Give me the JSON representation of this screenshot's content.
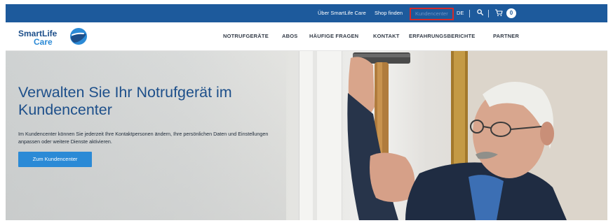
{
  "topbar": {
    "about_label": "Über SmartLife Care",
    "shop_label": "Shop finden",
    "kundencenter_label": "Kundencenter",
    "language_label": "DE",
    "search_icon": "search-icon",
    "cart_icon": "cart-icon",
    "cart_count": "0",
    "colors": {
      "bar": "#1d5a9c",
      "highlight_border": "#d42a2a"
    }
  },
  "header": {
    "logo": {
      "line1": "SmartLife",
      "line2": "Care"
    },
    "nav": [
      {
        "label": "NOTRUFGERÄTE"
      },
      {
        "label": "ABOS"
      },
      {
        "label": "HÄUFIGE FRAGEN"
      },
      {
        "label": "KONTAKT"
      },
      {
        "label": "ERFAHRUNGSBERICHTE"
      },
      {
        "label": "PARTNER"
      }
    ]
  },
  "hero": {
    "title": "Verwalten Sie Ihr Notrufgerät im Kundencenter",
    "description": "Im Kundencenter können Sie jederzeit Ihre Kontaktpersonen ändern, Ihre persönlichen Daten und Einstellungen anpassen oder weitere Dienste aktivieren.",
    "cta_label": "Zum Kundencenter",
    "colors": {
      "title": "#1d4f8a",
      "button": "#2b8ad6"
    }
  }
}
